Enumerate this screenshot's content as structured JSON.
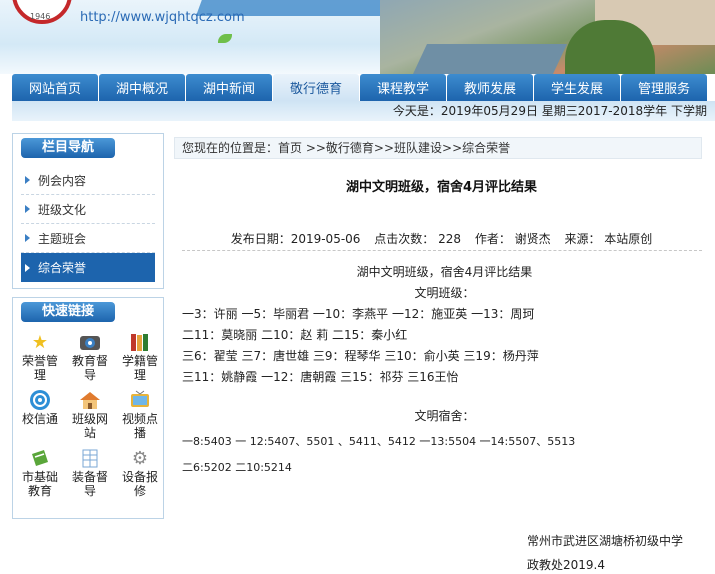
{
  "header": {
    "logo_year": "1946",
    "site_url": "http://www.wjqhtqcz.com"
  },
  "nav": {
    "items": [
      "网站首页",
      "湖中概况",
      "湖中新闻",
      "敬行德育",
      "课程教学",
      "教师发展",
      "学生发展",
      "管理服务"
    ],
    "active_index": 3
  },
  "date_bar": "今天是：2019年05月29日 星期三2017-2018学年 下学期",
  "sidebar": {
    "nav_title": "栏目导航",
    "nav_items": [
      "例会内容",
      "班级文化",
      "主题班会",
      "综合荣誉"
    ],
    "active_item": "综合荣誉",
    "links_title": "快速链接",
    "links": [
      {
        "label": "荣誉管理",
        "icon": "star-icon"
      },
      {
        "label": "教育督导",
        "icon": "camera-icon"
      },
      {
        "label": "学籍管理",
        "icon": "books-icon"
      },
      {
        "label": "校信通",
        "icon": "signal-icon"
      },
      {
        "label": "班级网站",
        "icon": "house-icon"
      },
      {
        "label": "视频点播",
        "icon": "tv-icon"
      },
      {
        "label": "市基础教育",
        "icon": "green-book-icon"
      },
      {
        "label": "装备督导",
        "icon": "grid-doc-icon"
      },
      {
        "label": "设备报修",
        "icon": "gears-icon"
      }
    ]
  },
  "breadcrumb": "您现在的位置是：首页 >>敬行德育>>班队建设>>综合荣誉",
  "article": {
    "title": "湖中文明班级，宿舍4月评比结果",
    "meta": {
      "date": "发布日期：2019-05-06",
      "clicks": "点击次数：  228",
      "author": "作者：  谢贤杰",
      "source": "来源：  本站原创"
    },
    "subtitle": "湖中文明班级，宿舍4月评比结果",
    "class_heading": "文明班级：",
    "class_lines": [
      "一3：许丽    一5：毕丽君    一10：李燕平     一12：施亚英    一13：周珂",
      "二11：莫晓丽   二10：赵 莉    二15：秦小红",
      "三6：翟莹    三7：唐世雄   三9：程琴华   三10：俞小英   三19：杨丹萍",
      "三11：姚静霞   一12：唐朝霞   三15：祁芬   三16王怡"
    ],
    "dorm_heading": "文明宿舍：",
    "dorm_lines": [
      "一8:5403      一 12:5407、5501  、5411、5412      一13:5504    一14:5507、5513",
      "二6:5202      二10:5214"
    ],
    "signature_org": "常州市武进区湖塘桥初级中学",
    "signature_dept": "政教处2019.4"
  }
}
